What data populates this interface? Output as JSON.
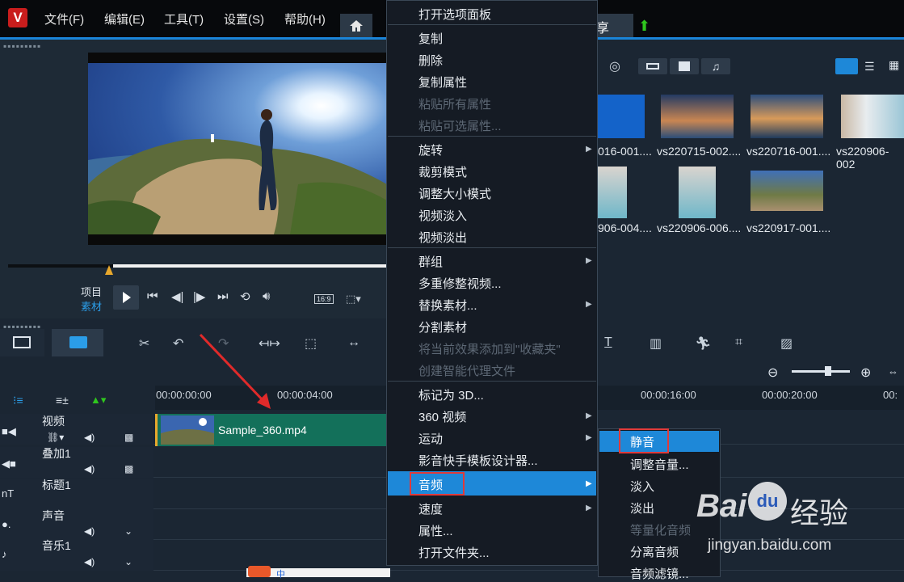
{
  "app": {
    "logo": "V"
  },
  "menu": [
    "文件(F)",
    "编辑(E)",
    "工具(T)",
    "设置(S)",
    "帮助(H)"
  ],
  "tabs": {
    "share_partial": "享"
  },
  "player": {
    "project_label": "项目",
    "clip_label": "素材",
    "aspect": "16:9"
  },
  "library": {
    "row1": [
      "016-001....",
      "vs220715-002....",
      "vs220716-001....",
      "vs220906-002"
    ],
    "row2": [
      "906-004....",
      "vs220906-006....",
      "vs220917-001...."
    ]
  },
  "timeline": {
    "ruler": [
      "00:00:00:00",
      "00:00:04:00",
      "00:00:16:00",
      "00:00:20:00",
      "00:"
    ],
    "tracks": [
      "视频",
      "叠加1",
      "标题1",
      "声音",
      "音乐1"
    ],
    "clip_name": "Sample_360.mp4"
  },
  "context_menu": {
    "items": [
      {
        "label": "打开选项面板",
        "disabled": false
      },
      {
        "label": "复制",
        "disabled": false
      },
      {
        "label": "删除",
        "disabled": false
      },
      {
        "label": "复制属性",
        "disabled": false
      },
      {
        "label": "粘贴所有属性",
        "disabled": true
      },
      {
        "label": "粘贴可选属性...",
        "disabled": true
      },
      {
        "label": "旋转",
        "disabled": false,
        "sub": true
      },
      {
        "label": "裁剪模式",
        "disabled": false
      },
      {
        "label": "调整大小模式",
        "disabled": false
      },
      {
        "label": "视频淡入",
        "disabled": false
      },
      {
        "label": "视频淡出",
        "disabled": false
      },
      {
        "label": "群组",
        "disabled": false,
        "sub": true
      },
      {
        "label": "多重修整视频...",
        "disabled": false
      },
      {
        "label": "替换素材...",
        "disabled": false,
        "sub": true
      },
      {
        "label": "分割素材",
        "disabled": false
      },
      {
        "label": "将当前效果添加到\"收藏夹\"",
        "disabled": true
      },
      {
        "label": "创建智能代理文件",
        "disabled": true
      },
      {
        "label": "标记为 3D...",
        "disabled": false
      },
      {
        "label": "360 视频",
        "disabled": false,
        "sub": true
      },
      {
        "label": "运动",
        "disabled": false,
        "sub": true
      },
      {
        "label": "影音快手模板设计器...",
        "disabled": false
      },
      {
        "label": "音频",
        "disabled": false,
        "sub": true
      },
      {
        "label": "速度",
        "disabled": false,
        "sub": true
      },
      {
        "label": "属性...",
        "disabled": false
      },
      {
        "label": "打开文件夹...",
        "disabled": false
      }
    ]
  },
  "audio_submenu": [
    {
      "label": "静音",
      "disabled": false
    },
    {
      "label": "调整音量...",
      "disabled": false
    },
    {
      "label": "淡入",
      "disabled": false
    },
    {
      "label": "淡出",
      "disabled": false
    },
    {
      "label": "等量化音频",
      "disabled": true
    },
    {
      "label": "分离音频",
      "disabled": false
    },
    {
      "label": "音频滤镜...",
      "disabled": false
    }
  ],
  "watermark": {
    "brand": "Bai",
    "brand2": "du",
    "cn": "经验",
    "url": "jingyan.baidu.com"
  },
  "taskbar": {
    "ime": "中"
  },
  "colors": {
    "accent": "#1e88d8",
    "highlight_box": "#e03a3a",
    "clip": "#13705a",
    "menu_bg": "#151b24"
  }
}
